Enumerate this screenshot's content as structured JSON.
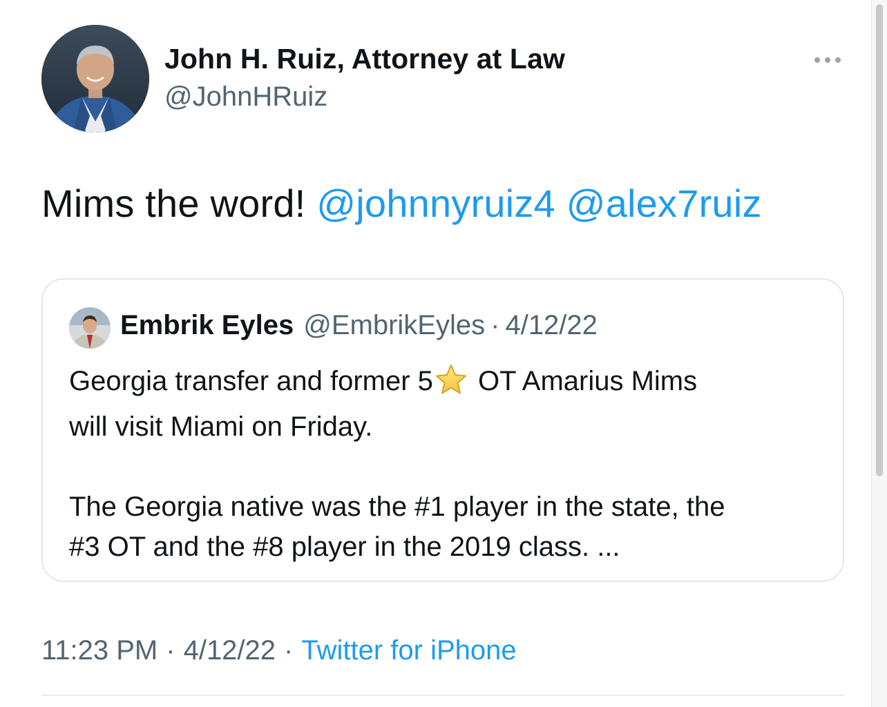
{
  "author": {
    "name": "John H. Ruiz, Attorney at Law",
    "handle": "@JohnHRuiz",
    "avatar_icon": "profile-photo-man-blue-suit"
  },
  "more_icon": "more-horizontal-icon",
  "tweet": {
    "text": "Mims the word!",
    "mentions": [
      "@johnnyruiz4",
      "@alex7ruiz"
    ]
  },
  "quoted": {
    "name": "Embrik Eyles",
    "handle": "@EmbrikEyles",
    "separator": "·",
    "date": "4/12/22",
    "avatar_icon": "profile-photo-man-red-tie",
    "line1_pre": "Georgia transfer and former 5",
    "star_icon": "star-emoji",
    "line1_post": " OT Amarius Mims",
    "line2": "will visit Miami on Friday.",
    "line3": "The Georgia native was the #1 player in the state, the",
    "line4": "#3 OT and the #8 player in the 2019 class. ..."
  },
  "meta": {
    "time": "11:23 PM",
    "separator": "·",
    "date": "4/12/22",
    "source": "Twitter for iPhone"
  },
  "colors": {
    "link": "#1d9bf0",
    "secondary_text": "#536471",
    "primary_text": "#0f1419",
    "border": "#e1e8ed"
  }
}
